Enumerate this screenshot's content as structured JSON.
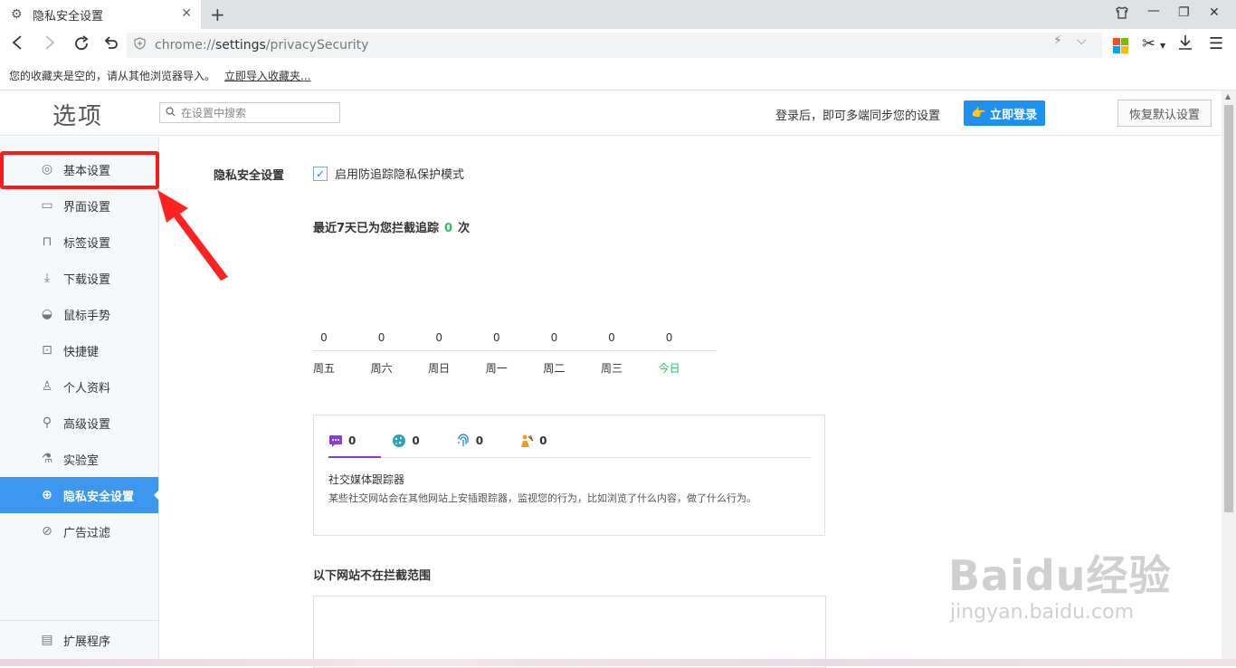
{
  "tab": {
    "title": "隐私安全设置",
    "icon": "gear-icon"
  },
  "omnibox": {
    "scheme": "chrome://",
    "host": "settings",
    "path": "/privacySecurity"
  },
  "bookmarks": {
    "empty_text": "您的收藏夹是空的，请从其他浏览器导入。",
    "import_link": "立即导入收藏夹..."
  },
  "header": {
    "title": "选项",
    "search_placeholder": "在设置中搜索",
    "login_hint": "登录后，即可多端同步您的设置",
    "login_button": "立即登录",
    "reset_button": "恢复默认设置"
  },
  "sidebar": {
    "items": [
      {
        "label": "基本设置",
        "icon": "settings-circle-icon"
      },
      {
        "label": "界面设置",
        "icon": "window-icon"
      },
      {
        "label": "标签设置",
        "icon": "tab-icon"
      },
      {
        "label": "下载设置",
        "icon": "download-icon"
      },
      {
        "label": "鼠标手势",
        "icon": "mouse-icon"
      },
      {
        "label": "快捷键",
        "icon": "keyboard-icon"
      },
      {
        "label": "个人资料",
        "icon": "user-icon"
      },
      {
        "label": "高级设置",
        "icon": "wrench-icon"
      },
      {
        "label": "实验室",
        "icon": "flask-icon"
      },
      {
        "label": "隐私安全设置",
        "icon": "shield-plus-icon"
      },
      {
        "label": "广告过滤",
        "icon": "block-icon"
      }
    ],
    "active_index": 9,
    "footer": {
      "label": "扩展程序",
      "icon": "extension-icon"
    }
  },
  "privacy": {
    "section_label": "隐私安全设置",
    "checkbox_label": "启用防追踪隐私保护模式",
    "checkbox_checked": true,
    "stat_prefix": "最近7天已为您拦截追踪",
    "stat_count": "0",
    "stat_suffix": "次"
  },
  "chart_data": {
    "type": "bar",
    "categories": [
      "周五",
      "周六",
      "周日",
      "周一",
      "周二",
      "周三",
      "今日"
    ],
    "values": [
      0,
      0,
      0,
      0,
      0,
      0,
      0
    ],
    "highlight_color": "#2bbd6c"
  },
  "trackers": {
    "tabs": [
      {
        "icon": "chat-icon",
        "count": "0",
        "color": "#8a3dd6"
      },
      {
        "icon": "cookie-icon",
        "count": "0",
        "color": "#2aa5b8"
      },
      {
        "icon": "fingerprint-icon",
        "count": "0",
        "color": "#1e78d6"
      },
      {
        "icon": "miner-icon",
        "count": "0",
        "color": "#f0a020"
      }
    ],
    "active_title": "社交媒体跟踪器",
    "active_desc": "某些社交网站会在其他网站上安插跟踪器，监视您的行为，比如浏览了什么内容，做了什么行为。"
  },
  "whitelist": {
    "title": "以下网站不在拦截范围"
  },
  "watermark": {
    "line1": "Baidu经验",
    "line2": "jingyan.baidu.com"
  }
}
